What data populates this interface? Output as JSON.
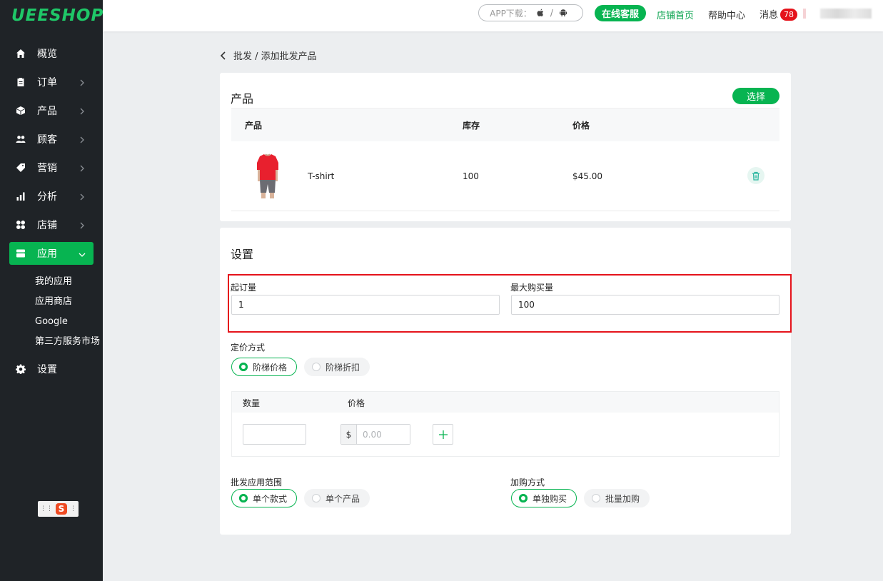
{
  "brand": {
    "logo_text": "UEESHOP"
  },
  "sidebar": {
    "items": [
      {
        "label": "概览",
        "icon": "home-icon",
        "has_arrow": false
      },
      {
        "label": "订单",
        "icon": "clipboard-icon",
        "has_arrow": true
      },
      {
        "label": "产品",
        "icon": "box-icon",
        "has_arrow": true
      },
      {
        "label": "顾客",
        "icon": "users-icon",
        "has_arrow": true
      },
      {
        "label": "营销",
        "icon": "tag-icon",
        "has_arrow": true
      },
      {
        "label": "分析",
        "icon": "bar-chart-icon",
        "has_arrow": true
      },
      {
        "label": "店铺",
        "icon": "grid-icon",
        "has_arrow": true
      },
      {
        "label": "应用",
        "icon": "app-icon",
        "has_arrow": true,
        "active": true
      },
      {
        "label": "设置",
        "icon": "gear-icon",
        "has_arrow": false
      }
    ],
    "sub_items": [
      "我的应用",
      "应用商店",
      "Google",
      "第三方服务市场"
    ],
    "accent": "#07b451"
  },
  "topbar": {
    "app_download": "APP下载：",
    "app_separator": "/",
    "service_button": "在线客服",
    "store_home": "店铺首页",
    "help_center": "帮助中心",
    "messages": "消息",
    "message_count": "78"
  },
  "breadcrumb": {
    "text": "批发 / 添加批发产品"
  },
  "products": {
    "title": "产品",
    "select_button": "选择",
    "columns": {
      "product": "产品",
      "stock": "库存",
      "price": "价格"
    },
    "rows": [
      {
        "name": "T-shirt",
        "stock": "100",
        "price": "$45.00"
      }
    ]
  },
  "settings": {
    "title": "设置",
    "min_order_label": "起订量",
    "min_order_value": "1",
    "max_purchase_label": "最大购买量",
    "max_purchase_value": "100",
    "pricing_label": "定价方式",
    "pricing_options": [
      "阶梯价格",
      "阶梯折扣"
    ],
    "tier_columns": {
      "quantity": "数量",
      "price": "价格"
    },
    "currency_symbol": "$",
    "price_placeholder": "0.00",
    "scope_label": "批发应用范围",
    "scope_options": [
      "单个款式",
      "单个产品"
    ],
    "add_mode_label": "加购方式",
    "add_mode_options": [
      "单独购买",
      "批量加购"
    ]
  },
  "colors": {
    "primary": "#07b451",
    "highlight": "#e5131b",
    "sidebar_bg": "#1f2327"
  }
}
